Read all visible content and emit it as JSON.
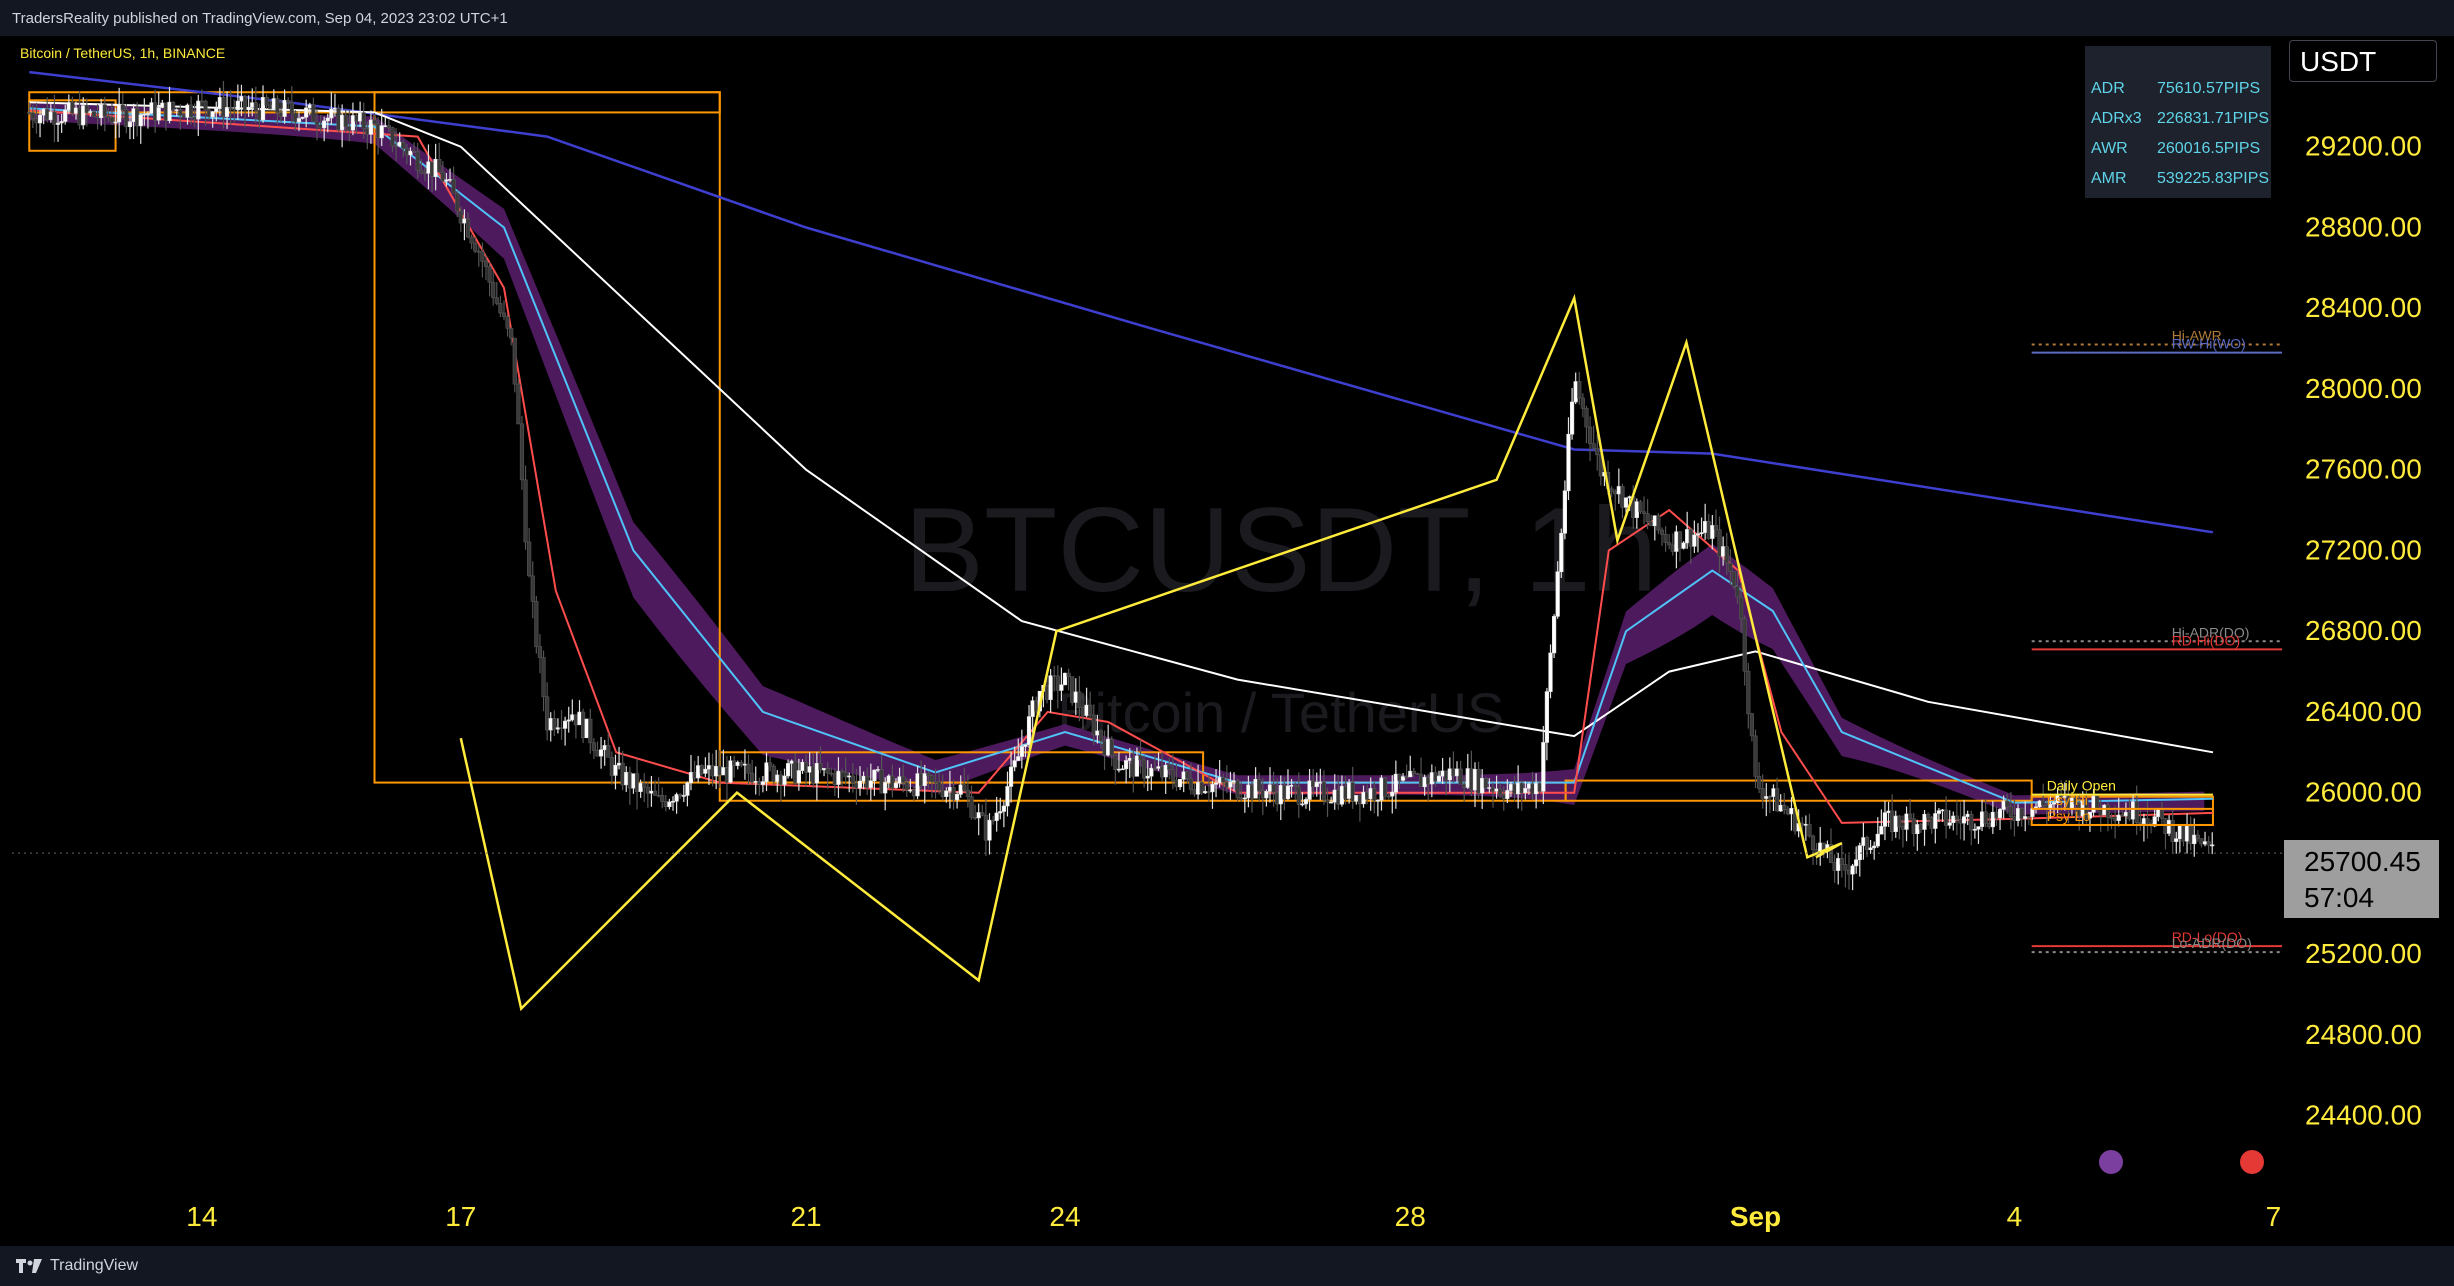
{
  "header": {
    "published_text": "TradersReality published on TradingView.com, Sep 04, 2023 23:02 UTC+1"
  },
  "footer": {
    "brand": "TradingView"
  },
  "ticker_button": {
    "label": "USDT"
  },
  "adr_table": [
    {
      "label": "ADR",
      "value": "75610.57PIPS"
    },
    {
      "label": "ADRx3",
      "value": "226831.71PIPS"
    },
    {
      "label": "AWR",
      "value": "260016.5PIPS"
    },
    {
      "label": "AMR",
      "value": "539225.83PIPS"
    }
  ],
  "current_price": {
    "price": "25700.45",
    "countdown": "57:04"
  },
  "colors": {
    "background": "#000000",
    "axis_text": "#ffeb3b",
    "pattern_line": "#ffeb3b",
    "ema_long": "#3f3fcf",
    "ema_mid": "#ffffff",
    "ema_fast": "#ff4d4d",
    "ema_teal": "#4fc3f7",
    "ribbon": "#5b1f6e",
    "box": "#ff9800"
  },
  "chart_data": {
    "type": "candlestick",
    "watermark": {
      "symbol": "BTCUSDT, 1h",
      "name": "Bitcoin / TetherUS"
    },
    "legend_text": "Bitcoin / TetherUS, 1h, BINANCE",
    "x_ticks": [
      "14",
      "17",
      "21",
      "24",
      "28",
      "Sep",
      "4",
      "7"
    ],
    "y_ticks": [
      "29200.00",
      "28800.00",
      "28400.00",
      "28000.00",
      "27600.00",
      "27200.00",
      "26800.00",
      "26400.00",
      "26000.00",
      "25600.00",
      "25200.00",
      "24800.00",
      "24400.00"
    ],
    "y_tick_values": [
      29200,
      28800,
      28400,
      28000,
      27600,
      27200,
      26800,
      26400,
      26000,
      25600,
      25200,
      24800,
      24400
    ],
    "ylim": [
      24200,
      29600
    ],
    "x_domain_days": [
      11.8,
      38.1
    ],
    "x_tick_days": [
      14,
      17,
      21,
      24,
      28,
      32,
      35,
      38
    ],
    "price_path": [
      [
        12.0,
        29370
      ],
      [
        13.0,
        29350
      ],
      [
        14.0,
        29400
      ],
      [
        15.0,
        29380
      ],
      [
        16.0,
        29300
      ],
      [
        16.8,
        29050
      ],
      [
        17.2,
        28700
      ],
      [
        17.6,
        28200
      ],
      [
        17.8,
        27000
      ],
      [
        18.0,
        26350
      ],
      [
        18.3,
        26400
      ],
      [
        18.8,
        26100
      ],
      [
        19.3,
        25950
      ],
      [
        19.8,
        26100
      ],
      [
        20.3,
        26100
      ],
      [
        21.0,
        26100
      ],
      [
        22.0,
        26050
      ],
      [
        22.8,
        26020
      ],
      [
        23.1,
        25800
      ],
      [
        23.4,
        26100
      ],
      [
        23.7,
        26500
      ],
      [
        24.0,
        26550
      ],
      [
        24.3,
        26350
      ],
      [
        24.6,
        26150
      ],
      [
        25.5,
        26050
      ],
      [
        26.5,
        26000
      ],
      [
        27.5,
        26000
      ],
      [
        28.5,
        26100
      ],
      [
        29.2,
        26000
      ],
      [
        29.5,
        26050
      ],
      [
        29.9,
        28050
      ],
      [
        30.2,
        27600
      ],
      [
        30.6,
        27400
      ],
      [
        31.0,
        27250
      ],
      [
        31.5,
        27300
      ],
      [
        31.8,
        27000
      ],
      [
        32.0,
        26050
      ],
      [
        32.5,
        25850
      ],
      [
        33.0,
        25600
      ],
      [
        33.5,
        25850
      ],
      [
        34.5,
        25870
      ],
      [
        35.5,
        25950
      ],
      [
        36.5,
        25900
      ],
      [
        37.3,
        25700
      ]
    ],
    "emas": [
      {
        "name": "EMA 200",
        "color": "#3f3fcf",
        "points": [
          [
            12.0,
            29570
          ],
          [
            15.0,
            29420
          ],
          [
            18.0,
            29250
          ],
          [
            21.0,
            28800
          ],
          [
            25.0,
            28300
          ],
          [
            29.9,
            27700
          ],
          [
            31.5,
            27680
          ],
          [
            37.3,
            27290
          ]
        ]
      },
      {
        "name": "EMA 100",
        "color": "#ffffff",
        "points": [
          [
            12.0,
            29420
          ],
          [
            16.0,
            29370
          ],
          [
            17.0,
            29200
          ],
          [
            19.0,
            28400
          ],
          [
            21.0,
            27600
          ],
          [
            23.5,
            26850
          ],
          [
            26.0,
            26560
          ],
          [
            29.9,
            26280
          ],
          [
            31.0,
            26600
          ],
          [
            32.0,
            26700
          ],
          [
            34.0,
            26450
          ],
          [
            37.3,
            26200
          ]
        ]
      },
      {
        "name": "EMA 50",
        "color": "#4fc3f7",
        "points": [
          [
            12.0,
            29390
          ],
          [
            16.0,
            29300
          ],
          [
            17.5,
            28800
          ],
          [
            19.0,
            27200
          ],
          [
            20.5,
            26400
          ],
          [
            22.5,
            26100
          ],
          [
            24.0,
            26300
          ],
          [
            26.0,
            26050
          ],
          [
            29.9,
            26050
          ],
          [
            30.5,
            26800
          ],
          [
            31.5,
            27100
          ],
          [
            32.2,
            26900
          ],
          [
            33.0,
            26300
          ],
          [
            35.0,
            25950
          ],
          [
            37.3,
            25970
          ]
        ]
      },
      {
        "name": "EMA 21",
        "color": "#ff4d4d",
        "points": [
          [
            12.0,
            29380
          ],
          [
            16.5,
            29250
          ],
          [
            17.5,
            28500
          ],
          [
            18.1,
            27000
          ],
          [
            18.8,
            26200
          ],
          [
            20.0,
            26050
          ],
          [
            23.0,
            26000
          ],
          [
            23.8,
            26400
          ],
          [
            24.5,
            26350
          ],
          [
            26.0,
            26000
          ],
          [
            29.9,
            26000
          ],
          [
            30.3,
            27200
          ],
          [
            31.0,
            27400
          ],
          [
            31.8,
            27100
          ],
          [
            32.3,
            26300
          ],
          [
            33.0,
            25850
          ],
          [
            35.0,
            25870
          ],
          [
            37.3,
            25900
          ]
        ]
      }
    ],
    "zigzag_pattern": [
      [
        17.0,
        26270
      ],
      [
        17.7,
        24930
      ],
      [
        20.2,
        26000
      ],
      [
        23.0,
        25070
      ],
      [
        23.9,
        26800
      ],
      [
        29.0,
        27550
      ],
      [
        29.9,
        28450
      ],
      [
        30.4,
        27250
      ],
      [
        31.2,
        28230
      ],
      [
        32.6,
        25680
      ],
      [
        33.0,
        25750
      ],
      [
        32.7,
        25680
      ]
    ],
    "boxes": [
      {
        "x0": 12.0,
        "x1": 13.0,
        "y0": 29430,
        "y1": 29180
      },
      {
        "x0": 12.0,
        "x1": 20.0,
        "y0": 29470,
        "y1": 29370
      },
      {
        "x0": 20.0,
        "x1": 25.6,
        "y0": 26200,
        "y1": 26050
      },
      {
        "x0": 20.0,
        "x1": 29.8,
        "y0": 26050,
        "y1": 25960
      },
      {
        "x0": 29.8,
        "x1": 35.2,
        "y0": 26060,
        "y1": 25960
      },
      {
        "x0": 35.2,
        "x1": 37.3,
        "y0": 25980,
        "y1": 25840
      },
      {
        "x0": 16.0,
        "x1": 20.0,
        "y0": 29470,
        "y1": 26050
      }
    ],
    "level_lines": [
      {
        "label": "Hi-AWR",
        "y": 28220,
        "x0": 35.2,
        "x1": 38.1,
        "color": "#b07a3a",
        "dotted": true
      },
      {
        "label": "RW-Hi(WO)",
        "y": 28180,
        "x0": 35.2,
        "x1": 38.1,
        "color": "#5c6bc0",
        "dotted": false
      },
      {
        "label": "Hi-ADR(DO)",
        "y": 26750,
        "x0": 35.2,
        "x1": 38.1,
        "color": "#8a8a8a",
        "dotted": true
      },
      {
        "label": "RD-Hi(DO)",
        "y": 26710,
        "x0": 35.2,
        "x1": 38.1,
        "color": "#e53935",
        "dotted": false
      },
      {
        "label": "Daily Open",
        "y": 25990,
        "x0": 35.2,
        "x1": 37.3,
        "color": "#ffeb3b",
        "dotted": false
      },
      {
        "label": "Psy-Hi",
        "y": 25920,
        "x0": 35.2,
        "x1": 37.3,
        "color": "#ff9800",
        "dotted": false
      },
      {
        "label": "Psy-Lo",
        "y": 25840,
        "x0": 35.2,
        "x1": 37.3,
        "color": "#ff9800",
        "dotted": false
      },
      {
        "label": "RD-Lo(DO)",
        "y": 25240,
        "x0": 35.2,
        "x1": 38.1,
        "color": "#e53935",
        "dotted": false
      },
      {
        "label": "Lo-ADR(DO)",
        "y": 25210,
        "x0": 35.2,
        "x1": 38.1,
        "color": "#8a8a8a",
        "dotted": true
      }
    ],
    "current_price_value": 25700.45
  }
}
